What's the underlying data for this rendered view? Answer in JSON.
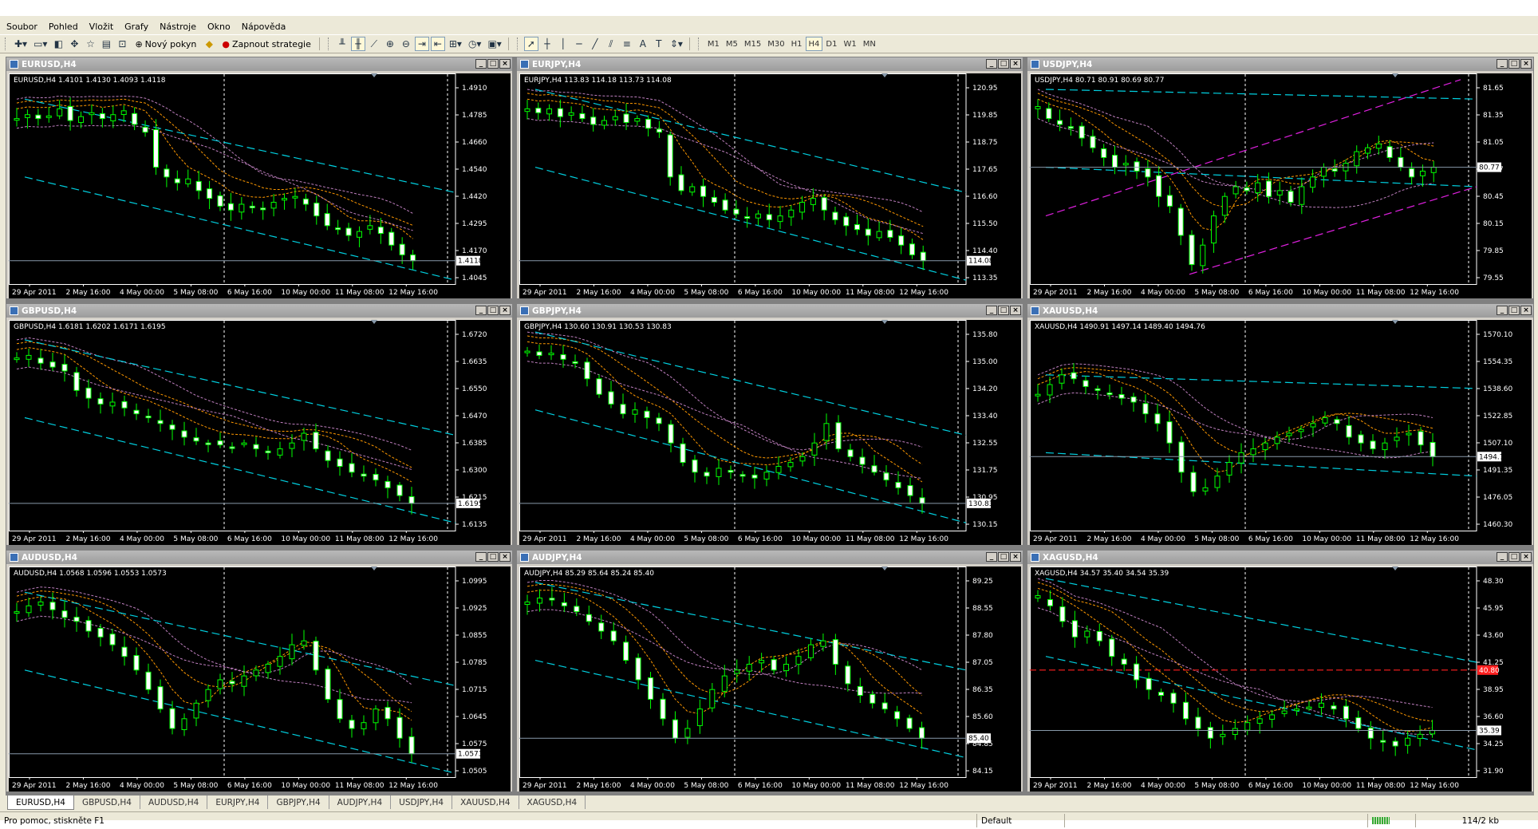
{
  "menu": [
    "Soubor",
    "Pohled",
    "Vložit",
    "Grafy",
    "Nástroje",
    "Okno",
    "Nápověda"
  ],
  "toolbar": {
    "new_order_label": "Nový pokyn",
    "experts_label": "Zapnout strategie",
    "timeframes": [
      "M1",
      "M5",
      "M15",
      "M30",
      "H1",
      "H4",
      "D1",
      "W1",
      "MN"
    ],
    "active_timeframe": "H4"
  },
  "colors": {
    "bull_candle": "#00ff00",
    "bear_candle": "#ffffff",
    "channel": "#00d0e0",
    "ma_orange": "#ff9900",
    "ma_pink": "#c080c0",
    "usdjpy_channel": "#e020e0",
    "xag_level": "#ff2020"
  },
  "date_axis": [
    "29 Apr 2011",
    "2 May 16:00",
    "4 May 00:00",
    "5 May 08:00",
    "6 May 16:00",
    "10 May 00:00",
    "11 May 08:00",
    "12 May 16:00"
  ],
  "charts": [
    {
      "title": "EURUSD,H4",
      "ohlc": "EURUSD,H4  1.4101 1.4130 1.4093 1.4118",
      "prices": [
        "1.4910",
        "1.4785",
        "1.4660",
        "1.4540",
        "1.4420",
        "1.4295",
        "1.4170",
        "1.4045"
      ],
      "current": "1.4118",
      "path": [
        0.85,
        0.87,
        0.85,
        0.86,
        0.9,
        0.84,
        0.86,
        0.88,
        0.85,
        0.87,
        0.89,
        0.82,
        0.78,
        0.6,
        0.55,
        0.52,
        0.54,
        0.48,
        0.44,
        0.4,
        0.38,
        0.41,
        0.4,
        0.39,
        0.42,
        0.44,
        0.45,
        0.41,
        0.35,
        0.3,
        0.28,
        0.25,
        0.27,
        0.3,
        0.26,
        0.2,
        0.15,
        0.12
      ]
    },
    {
      "title": "EURJPY,H4",
      "ohlc": "EURJPY,H4  113.83 114.18 113.73 114.08",
      "prices": [
        "120.95",
        "119.85",
        "118.75",
        "117.65",
        "116.60",
        "115.50",
        "114.40",
        "113.35"
      ],
      "current": "114.08",
      "path": [
        0.9,
        0.88,
        0.9,
        0.86,
        0.88,
        0.85,
        0.82,
        0.84,
        0.86,
        0.83,
        0.85,
        0.8,
        0.78,
        0.55,
        0.48,
        0.5,
        0.45,
        0.42,
        0.38,
        0.36,
        0.34,
        0.36,
        0.33,
        0.35,
        0.38,
        0.42,
        0.44,
        0.38,
        0.33,
        0.3,
        0.28,
        0.25,
        0.27,
        0.24,
        0.2,
        0.15,
        0.12
      ]
    },
    {
      "title": "USDJPY,H4",
      "ohlc": "USDJPY,H4  80.71 80.91 80.69 80.77",
      "prices": [
        "81.65",
        "81.35",
        "81.05",
        "80.77",
        "80.45",
        "80.15",
        "79.85",
        "79.55"
      ],
      "current": "80.77",
      "path": [
        0.9,
        0.85,
        0.82,
        0.8,
        0.75,
        0.7,
        0.65,
        0.6,
        0.62,
        0.58,
        0.55,
        0.45,
        0.4,
        0.25,
        0.1,
        0.2,
        0.35,
        0.45,
        0.5,
        0.48,
        0.52,
        0.45,
        0.48,
        0.42,
        0.5,
        0.55,
        0.6,
        0.58,
        0.62,
        0.68,
        0.7,
        0.72,
        0.65,
        0.6,
        0.55,
        0.58,
        0.6
      ]
    },
    {
      "title": "GBPUSD,H4",
      "ohlc": "GBPUSD,H4  1.6181 1.6202 1.6171 1.6195",
      "prices": [
        "1.6720",
        "1.6635",
        "1.6550",
        "1.6470",
        "1.6385",
        "1.6300",
        "1.6215",
        "1.6135"
      ],
      "current": "1.6195",
      "path": [
        0.88,
        0.9,
        0.86,
        0.84,
        0.82,
        0.72,
        0.68,
        0.65,
        0.66,
        0.63,
        0.6,
        0.58,
        0.55,
        0.52,
        0.48,
        0.46,
        0.45,
        0.44,
        0.43,
        0.45,
        0.42,
        0.4,
        0.42,
        0.45,
        0.5,
        0.42,
        0.36,
        0.33,
        0.3,
        0.28,
        0.26,
        0.22,
        0.18,
        0.14
      ]
    },
    {
      "title": "GBPJPY,H4",
      "ohlc": "GBPJPY,H4  130.60 130.91 130.53 130.83",
      "prices": [
        "135.80",
        "135.00",
        "134.20",
        "133.40",
        "132.55",
        "131.75",
        "130.95",
        "130.15"
      ],
      "current": "130.83",
      "path": [
        0.92,
        0.9,
        0.91,
        0.88,
        0.86,
        0.78,
        0.7,
        0.65,
        0.6,
        0.62,
        0.58,
        0.55,
        0.45,
        0.35,
        0.3,
        0.28,
        0.32,
        0.3,
        0.28,
        0.27,
        0.3,
        0.33,
        0.35,
        0.38,
        0.45,
        0.55,
        0.42,
        0.38,
        0.34,
        0.3,
        0.26,
        0.22,
        0.18,
        0.14
      ]
    },
    {
      "title": "XAUUSD,H4",
      "ohlc": "XAUUSD,H4  1490.91 1497.14 1489.40 1494.76",
      "prices": [
        "1570.10",
        "1554.35",
        "1538.60",
        "1522.85",
        "1507.10",
        "1491.35",
        "1476.05",
        "1460.30"
      ],
      "current": "1494.76",
      "path": [
        0.7,
        0.75,
        0.8,
        0.78,
        0.74,
        0.72,
        0.7,
        0.68,
        0.66,
        0.6,
        0.55,
        0.45,
        0.3,
        0.2,
        0.22,
        0.28,
        0.35,
        0.4,
        0.42,
        0.45,
        0.48,
        0.5,
        0.52,
        0.55,
        0.58,
        0.55,
        0.48,
        0.45,
        0.42,
        0.45,
        0.48,
        0.5,
        0.44,
        0.38
      ]
    },
    {
      "title": "AUDUSD,H4",
      "ohlc": "AUDUSD,H4  1.0568 1.0596 1.0553 1.0573",
      "prices": [
        "1.0995",
        "1.0925",
        "1.0855",
        "1.0785",
        "1.0715",
        "1.0645",
        "1.0575",
        "1.0505"
      ],
      "current": "1.0573",
      "path": [
        0.85,
        0.88,
        0.9,
        0.86,
        0.82,
        0.8,
        0.75,
        0.72,
        0.68,
        0.62,
        0.55,
        0.45,
        0.35,
        0.25,
        0.3,
        0.38,
        0.45,
        0.5,
        0.48,
        0.52,
        0.55,
        0.58,
        0.62,
        0.68,
        0.7,
        0.55,
        0.4,
        0.3,
        0.25,
        0.28,
        0.35,
        0.3,
        0.2,
        0.12
      ]
    },
    {
      "title": "AUDJPY,H4",
      "ohlc": "AUDJPY,H4  85.29 85.64 85.24 85.40",
      "prices": [
        "89.25",
        "88.55",
        "87.80",
        "87.05",
        "86.35",
        "85.60",
        "84.85",
        "84.15"
      ],
      "current": "85.40",
      "path": [
        0.9,
        0.92,
        0.91,
        0.88,
        0.85,
        0.8,
        0.75,
        0.7,
        0.6,
        0.5,
        0.4,
        0.3,
        0.2,
        0.25,
        0.35,
        0.45,
        0.52,
        0.55,
        0.58,
        0.6,
        0.55,
        0.58,
        0.62,
        0.68,
        0.7,
        0.58,
        0.48,
        0.42,
        0.38,
        0.35,
        0.3,
        0.25,
        0.2
      ]
    },
    {
      "title": "XAGUSD,H4",
      "ohlc": "XAGUSD,H4  34.57 35.40 34.54 35.39",
      "prices": [
        "48.30",
        "45.95",
        "43.60",
        "41.25",
        "38.95",
        "36.60",
        "34.25",
        "31.90"
      ],
      "current": "35.39",
      "level": "40.80",
      "path": [
        0.92,
        0.88,
        0.8,
        0.72,
        0.75,
        0.7,
        0.62,
        0.58,
        0.5,
        0.45,
        0.42,
        0.38,
        0.3,
        0.25,
        0.2,
        0.22,
        0.25,
        0.28,
        0.3,
        0.32,
        0.34,
        0.35,
        0.36,
        0.38,
        0.35,
        0.3,
        0.25,
        0.2,
        0.18,
        0.16,
        0.2,
        0.22,
        0.24
      ]
    }
  ],
  "tabs": [
    "EURUSD,H4",
    "GBPUSD,H4",
    "AUDUSD,H4",
    "EURJPY,H4",
    "GBPJPY,H4",
    "AUDJPY,H4",
    "USDJPY,H4",
    "XAUUSD,H4",
    "XAGUSD,H4"
  ],
  "status": {
    "help": "Pro pomoc, stiskněte F1",
    "profile": "Default",
    "traffic": "114/2 kb"
  }
}
